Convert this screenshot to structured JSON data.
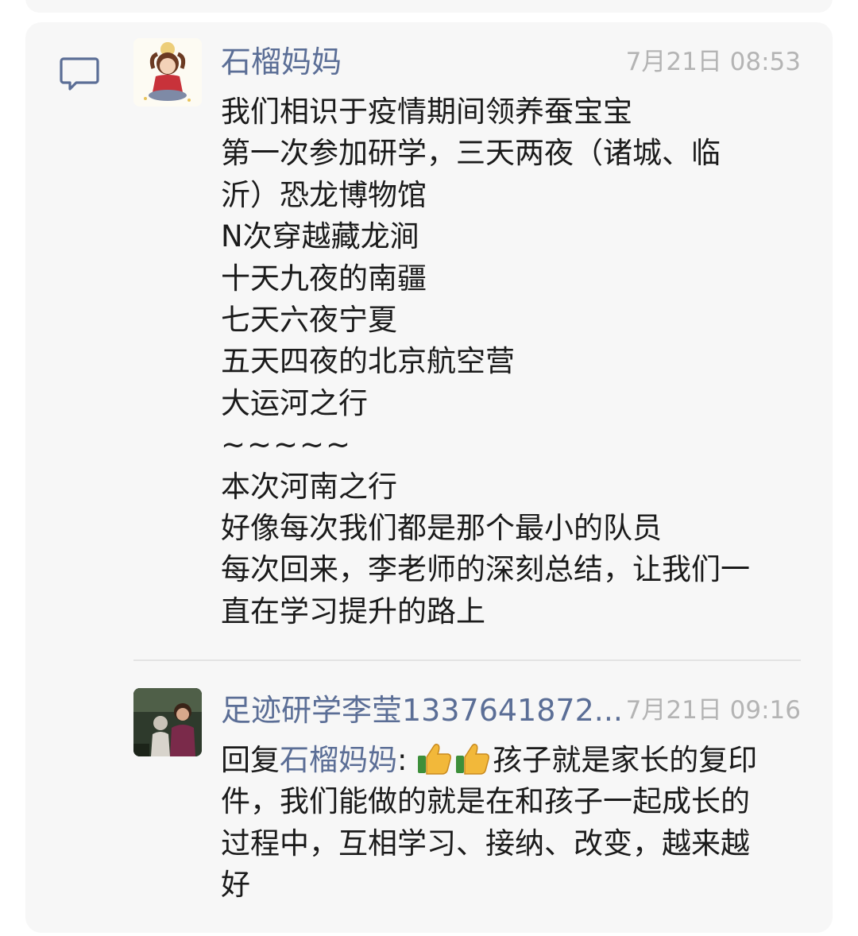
{
  "post": {
    "author": "石榴妈妈",
    "time": "7月21日 08:53",
    "lines": [
      "我们相识于疫情期间领养蚕宝宝",
      "第一次参加研学，三天两夜（诸城、临",
      "沂）恐龙博物馆",
      "N次穿越藏龙涧",
      "十天九夜的南疆",
      "七天六夜宁夏",
      "五天四夜的北京航空营",
      "大运河之行",
      "~~~~~",
      "本次河南之行",
      "好像每次我们都是那个最小的队员",
      "每次回来，李老师的深刻总结，让我们一",
      "直在学习提升的路上"
    ]
  },
  "reply": {
    "author": "足迹研学李莹1337641872...",
    "time": "7月21日 09:16",
    "prefix": "回复",
    "target": "石榴妈妈",
    "colon": ":",
    "emoji_icons": [
      "thumbs-up-icon",
      "thumbs-up-icon"
    ],
    "line1_text": "孩子就是家长的复印",
    "lines": [
      "件，我们能做的就是在和孩子一起成长的",
      "过程中，互相学习、接纳、改变，越来越",
      "好"
    ]
  },
  "colors": {
    "name": "#5b6e96",
    "time": "#b4b4b4",
    "text": "#1b1b1b",
    "card": "#f7f7f7"
  }
}
